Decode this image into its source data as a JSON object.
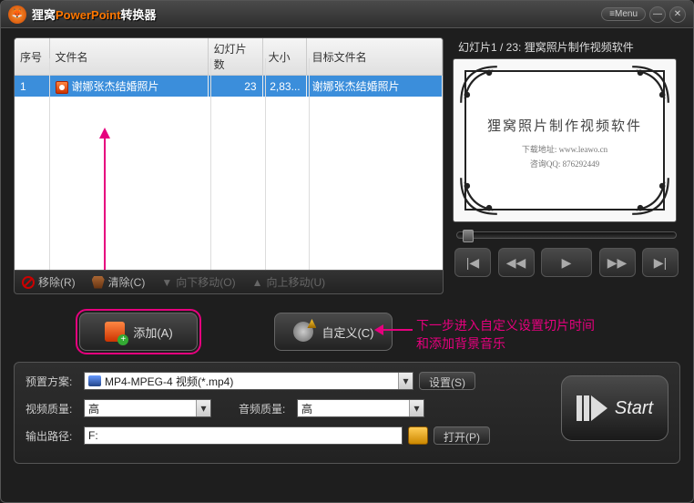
{
  "app": {
    "title_prefix": "狸窝",
    "title_pp": "PowerPoint",
    "title_suffix": "转换器",
    "menu": "Menu"
  },
  "table": {
    "headers": {
      "num": "序号",
      "filename": "文件名",
      "slides": "幻灯片数",
      "size": "大小",
      "target": "目标文件名"
    },
    "rows": [
      {
        "num": "1",
        "filename": "谢娜张杰结婚照片",
        "slides": "23",
        "size": "2,83...",
        "target": "谢娜张杰结婚照片"
      }
    ]
  },
  "toolbar": {
    "remove": "移除(R)",
    "clear": "清除(C)",
    "movedown": "向下移动(O)",
    "moveup": "向上移动(U)"
  },
  "preview": {
    "label": "幻灯片1 / 23: 狸窝照片制作视频软件",
    "line1": "狸窝照片制作视频软件",
    "line2": "下载地址: www.leawo.cn",
    "line3": "咨询QQ: 876292449"
  },
  "mid": {
    "add": "添加(A)",
    "custom": "自定义(C)"
  },
  "annotation": {
    "line1": "下一步进入自定义设置切片时间",
    "line2": "和添加背景音乐"
  },
  "settings": {
    "preset_label": "预置方案:",
    "preset_value": "MP4-MPEG-4 视频(*.mp4)",
    "set_btn": "设置(S)",
    "vq_label": "视频质量:",
    "vq_value": "高",
    "aq_label": "音频质量:",
    "aq_value": "高",
    "out_label": "输出路径:",
    "out_value": "F:",
    "open_btn": "打开(P)",
    "start": "Start"
  }
}
